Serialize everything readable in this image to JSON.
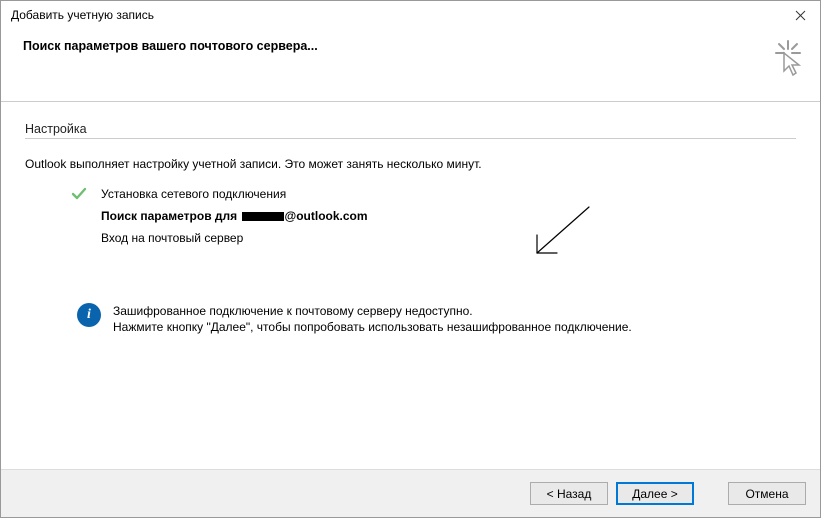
{
  "window": {
    "title": "Добавить учетную запись"
  },
  "header": {
    "title": "Поиск параметров вашего почтового сервера..."
  },
  "section": {
    "title": "Настройка",
    "intro": "Outlook выполняет настройку учетной записи. Это может занять несколько минут."
  },
  "steps": {
    "s1": "Установка сетевого подключения",
    "s2_prefix": "Поиск параметров для ",
    "s2_suffix": "@outlook.com",
    "s3": "Вход на почтовый сервер"
  },
  "info": {
    "line1": "Зашифрованное подключение к почтовому серверу недоступно.",
    "line2": "Нажмите кнопку \"Далее\", чтобы попробовать использовать незашифрованное подключение."
  },
  "buttons": {
    "back": "< Назад",
    "next": "Далее >",
    "cancel": "Отмена"
  }
}
